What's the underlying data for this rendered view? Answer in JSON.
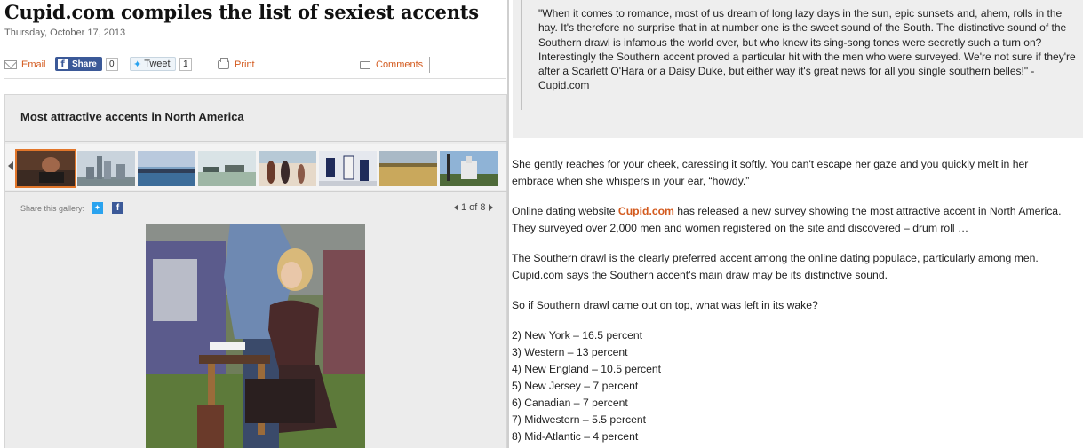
{
  "article": {
    "headline": "Cupid.com compiles the list of sexiest accents",
    "date": "Thursday, October 17, 2013"
  },
  "toolbar": {
    "email_label": "Email",
    "share_label": "Share",
    "share_count": "0",
    "tweet_label": "Tweet",
    "tweet_count": "1",
    "print_label": "Print",
    "comments_label": "Comments"
  },
  "gallery": {
    "title": "Most attractive accents in North America",
    "share_label": "Share this gallery:",
    "pager": "1 of 8",
    "thumb_count": 8
  },
  "quote": "\"When it comes to romance, most of us dream of long lazy days in the sun, epic sunsets and, ahem, rolls in the hay. It's therefore no surprise that in at number one is the sweet sound of the South. The distinctive sound of the Southern drawl is infamous the world over, but who knew its sing-song tones were secretly such a turn on? Interestingly the Southern accent proved a particular hit with the men who were surveyed. We're not sure if they're after a Scarlett O'Hara or a Daisy Duke, but either way it's great news for all you single southern belles!\" - Cupid.com",
  "body": {
    "p1": "She gently reaches for your cheek, caressing it softly. You can't escape her gaze and you quickly melt in her embrace when she whispers in your ear, “howdy.”",
    "p2_before": "Online dating website ",
    "p2_link": "Cupid.com",
    "p2_after": " has released a new survey showing the most attractive accent in North America. They surveyed over 2,000 men and women registered on the site and discovered – drum roll …",
    "p3": "The Southern drawl is the clearly preferred accent among the online dating populace, particularly among men. Cupid.com says the Southern accent's main draw may be its distinctive sound.",
    "p4": "So if Southern drawl came out on top, what was left in its wake?",
    "list": [
      "2) New York – 16.5 percent",
      "3) Western – 13 percent",
      "4) New England – 10.5 percent",
      "5) New Jersey – 7 percent",
      "6) Canadian – 7 percent",
      "7) Midwestern – 5.5 percent",
      "8) Mid-Atlantic – 4 percent"
    ]
  },
  "colors": {
    "accent": "#d35a1e",
    "facebook": "#3b5998",
    "twitter": "#2aa3ef"
  }
}
